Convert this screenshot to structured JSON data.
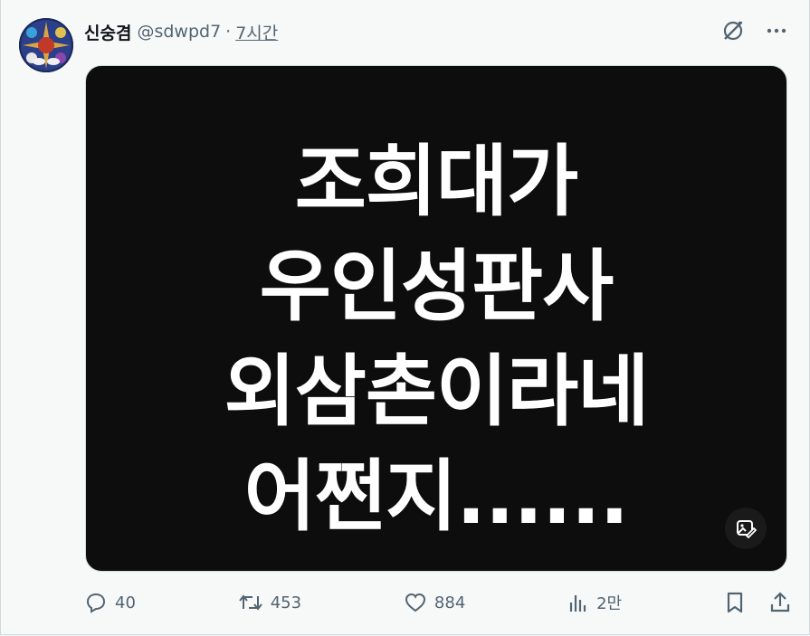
{
  "author": {
    "name": "신숭겸",
    "handle": "@sdwpd7",
    "separator": "·",
    "time": "7시간"
  },
  "media": {
    "lines": [
      "조희대가",
      "우인성판사",
      "외삼촌이라네",
      "어쩐지......"
    ]
  },
  "icons": {
    "grok": "grok-icon",
    "more": "more-icon",
    "edit_photo": "image-edit-icon",
    "reply": "reply-icon",
    "retweet": "retweet-icon",
    "like": "like-icon",
    "views": "views-icon",
    "bookmark": "bookmark-icon",
    "share": "share-icon"
  },
  "stats": {
    "replies": "40",
    "retweets": "453",
    "likes": "884",
    "views": "2만"
  },
  "colors": {
    "text": "#0f1419",
    "secondary": "#536471",
    "media_bg": "#0d0d0d"
  }
}
